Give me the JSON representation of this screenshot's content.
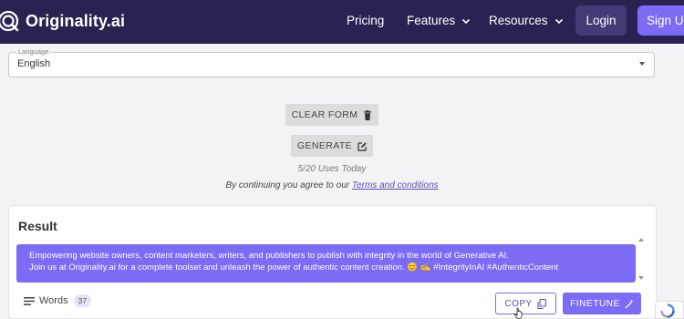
{
  "nav": {
    "brand": "Originality.ai",
    "links": [
      {
        "label": "Pricing"
      },
      {
        "label": "Features"
      },
      {
        "label": "Resources"
      }
    ],
    "login": "Login",
    "signup": "Sign Up"
  },
  "form": {
    "language_label": "Language",
    "language_value": "English",
    "clear_label": "CLEAR FORM",
    "generate_label": "GENERATE",
    "uses_text": "5/20 Uses Today",
    "agree_prefix": "By continuing you agree to our ",
    "agree_link": "Terms and conditions"
  },
  "result": {
    "title": "Result",
    "line1": "Empowering website owners, content marketers, writers, and publishers to publish with integrity in the world of Generative AI.",
    "line2": "Join us at Originality.ai for a complete toolset and unleash the power of authentic content creation. 😊 ✍️ #IntegrityInAI #AuthenticContent",
    "words_label": "Words",
    "words_count": "37",
    "copy_label": "COPY",
    "finetune_label": "FINETUNE"
  },
  "colors": {
    "navbar": "#2a2352",
    "accent": "#7b6bf5"
  }
}
